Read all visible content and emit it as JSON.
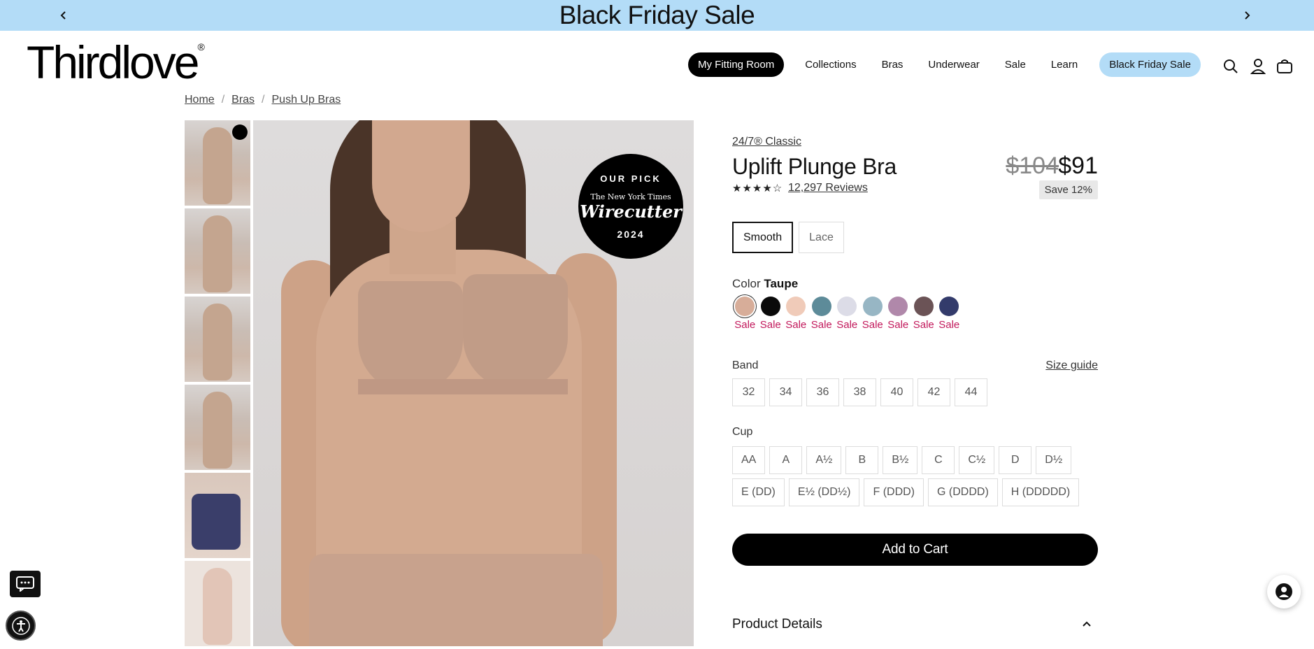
{
  "promo": {
    "text": "Black Friday Sale",
    "prev_icon": "chevron-left-icon",
    "next_icon": "chevron-right-icon",
    "bg_color": "#b3dcf7"
  },
  "header": {
    "logo": "Thirdlove",
    "logo_mark": "®",
    "nav": [
      "My Fitting Room",
      "Collections",
      "Bras",
      "Underwear",
      "Sale",
      "Learn",
      "Black Friday Sale"
    ],
    "icons": [
      "search-icon",
      "account-icon",
      "bag-icon"
    ]
  },
  "breadcrumb": [
    "Home",
    "Bras",
    "Push Up Bras"
  ],
  "breadcrumb_sep": "/",
  "badge": {
    "top": "OUR PICK",
    "publisher": "The New York Times",
    "name": "Wirecutter",
    "year": "2024"
  },
  "product": {
    "collection": "24/7® Classic",
    "title": "Uplift Plunge Bra",
    "price_original": "$104",
    "price_sale": "$91",
    "save": "Save 12%",
    "stars": "★★★★☆",
    "rating_value": 4.5,
    "reviews": "12,297 Reviews",
    "fabrics": [
      "Smooth",
      "Lace"
    ],
    "color_label": "Color",
    "color_selected": "Taupe",
    "colors": [
      {
        "hex": "#d7ad99",
        "tag": "Sale"
      },
      {
        "hex": "#0a0a0a",
        "tag": "Sale"
      },
      {
        "hex": "#f0cbb9",
        "tag": "Sale"
      },
      {
        "hex": "#5d8b99",
        "tag": "Sale"
      },
      {
        "hex": "#dcdce7",
        "tag": "Sale"
      },
      {
        "hex": "#97b6c4",
        "tag": "Sale"
      },
      {
        "hex": "#b088aa",
        "tag": "Sale"
      },
      {
        "hex": "#6b5356",
        "tag": "Sale"
      },
      {
        "hex": "#333b6b",
        "tag": "Sale"
      }
    ],
    "band_label": "Band",
    "size_guide": "Size guide",
    "bands": [
      "32",
      "34",
      "36",
      "38",
      "40",
      "42",
      "44"
    ],
    "cup_label": "Cup",
    "cups_row1": [
      "AA",
      "A",
      "A½",
      "B",
      "B½",
      "C",
      "C½",
      "D",
      "D½"
    ],
    "cups_row2": [
      "E (DD)",
      "E½ (DD½)",
      "F (DDD)",
      "G (DDDD)",
      "H (DDDDD)"
    ],
    "add_to_cart": "Add to Cart",
    "details_label": "Product Details"
  },
  "accent_sale": "#c2185b"
}
